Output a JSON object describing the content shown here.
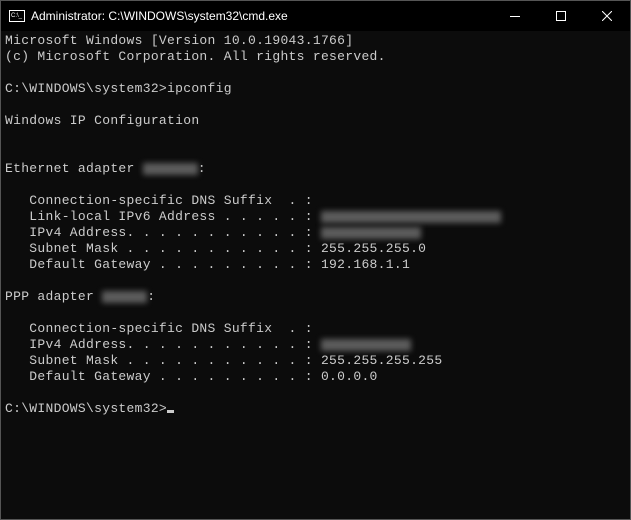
{
  "titlebar": {
    "title": "Administrator: C:\\WINDOWS\\system32\\cmd.exe"
  },
  "terminal": {
    "version_line": "Microsoft Windows [Version 10.0.19043.1766]",
    "copyright_line": "(c) Microsoft Corporation. All rights reserved.",
    "prompt1": "C:\\WINDOWS\\system32>",
    "command1": "ipconfig",
    "heading": "Windows IP Configuration",
    "adapter1": {
      "label_prefix": "Ethernet adapter ",
      "label_suffix": ":",
      "dns_suffix": "   Connection-specific DNS Suffix  . :",
      "ipv6": "   Link-local IPv6 Address . . . . . : ",
      "ipv4": "   IPv4 Address. . . . . . . . . . . : ",
      "subnet": "   Subnet Mask . . . . . . . . . . . : 255.255.255.0",
      "gateway": "   Default Gateway . . . . . . . . . : 192.168.1.1"
    },
    "adapter2": {
      "label_prefix": "PPP adapter ",
      "label_suffix": ":",
      "dns_suffix": "   Connection-specific DNS Suffix  . :",
      "ipv4": "   IPv4 Address. . . . . . . . . . . : ",
      "subnet": "   Subnet Mask . . . . . . . . . . . : 255.255.255.255",
      "gateway": "   Default Gateway . . . . . . . . . : 0.0.0.0"
    },
    "prompt2": "C:\\WINDOWS\\system32>"
  }
}
